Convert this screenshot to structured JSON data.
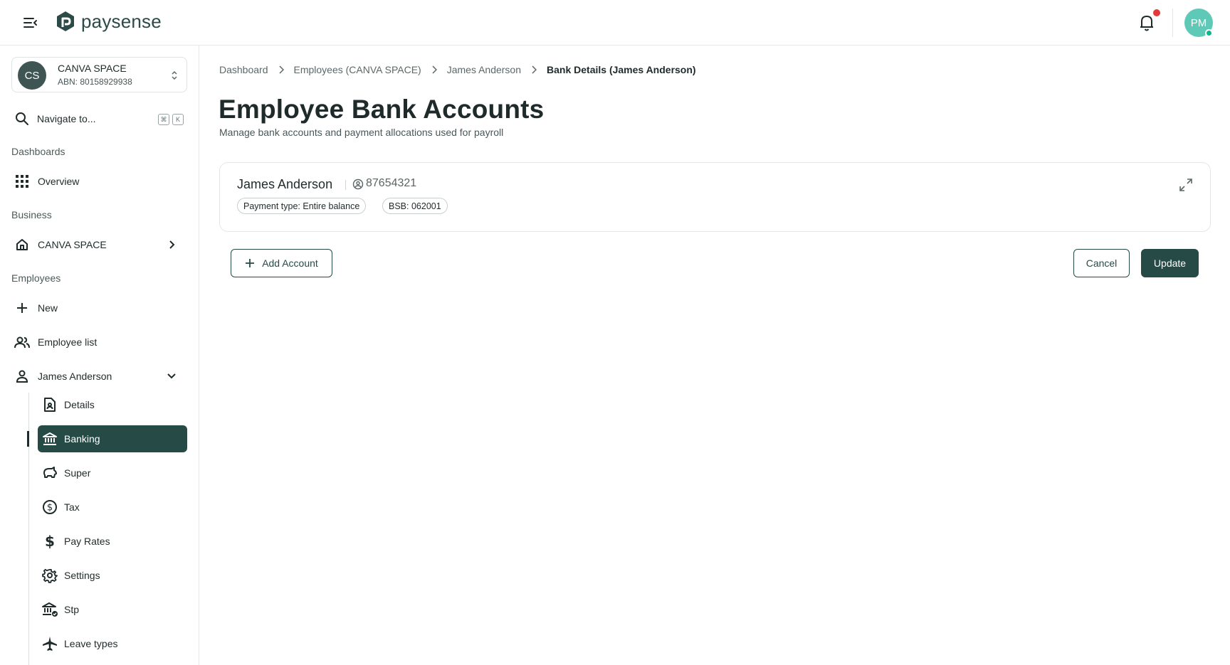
{
  "app": {
    "logo_text": "paysense"
  },
  "header": {
    "avatar_initials": "PM"
  },
  "sidebar": {
    "org": {
      "initials": "CS",
      "name": "CANVA SPACE",
      "abn": "ABN: 80158929938"
    },
    "search": {
      "label": "Navigate to...",
      "shortcut_keys": [
        "⌘",
        "K"
      ]
    },
    "sections": {
      "dashboards": "Dashboards",
      "business": "Business",
      "employees": "Employees"
    },
    "items": {
      "overview": "Overview",
      "canva_space": "CANVA SPACE",
      "new": "New",
      "employee_list": "Employee list",
      "james_anderson": "James Anderson"
    },
    "employee_sub_items": [
      {
        "label": "Details",
        "icon": "document-person-icon"
      },
      {
        "label": "Banking",
        "icon": "bank-icon",
        "active": true
      },
      {
        "label": "Super",
        "icon": "piggy-bank-icon"
      },
      {
        "label": "Tax",
        "icon": "dollar-circle-icon"
      },
      {
        "label": "Pay Rates",
        "icon": "dollar-icon"
      },
      {
        "label": "Settings",
        "icon": "gear-icon"
      },
      {
        "label": "Stp",
        "icon": "bank-check-icon"
      },
      {
        "label": "Leave types",
        "icon": "airplane-icon"
      }
    ]
  },
  "breadcrumb": [
    {
      "label": "Dashboard"
    },
    {
      "label": "Employees (CANVA SPACE)"
    },
    {
      "label": "James Anderson"
    },
    {
      "label": "Bank Details (James Anderson)",
      "current": true
    }
  ],
  "page": {
    "title": "Employee Bank Accounts",
    "subtitle": "Manage bank accounts and payment allocations used for payroll"
  },
  "account_card": {
    "name": "James Anderson",
    "account_number": "87654321",
    "chips": [
      "Payment type: Entire balance",
      "BSB: 062001"
    ]
  },
  "actions": {
    "add_account": "Add Account",
    "cancel": "Cancel",
    "update": "Update"
  },
  "colors": {
    "primary": "#264b47",
    "notification_dot": "#e23a3a",
    "avatar_bg": "#5fc9b8",
    "online_status": "#11b58d"
  }
}
